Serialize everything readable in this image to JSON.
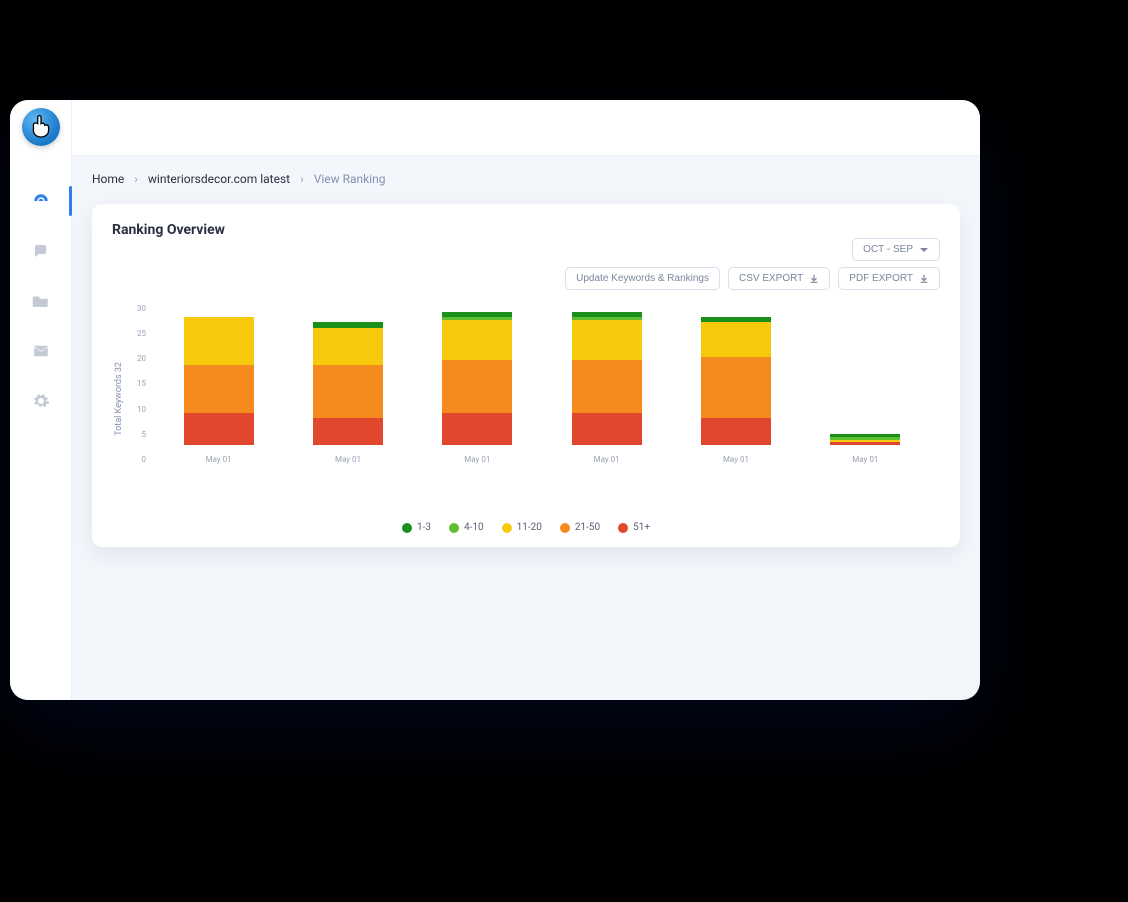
{
  "sidebar": {
    "logo_name": "pointer-logo",
    "items": [
      {
        "name": "dashboard-icon",
        "active": true
      },
      {
        "name": "chat-icon",
        "active": false
      },
      {
        "name": "folder-icon",
        "active": false
      },
      {
        "name": "mail-icon",
        "active": false
      },
      {
        "name": "gear-icon",
        "active": false
      }
    ]
  },
  "breadcrumb": {
    "home": "Home",
    "project": "winteriorsdecor.com latest",
    "current": "View Ranking"
  },
  "card": {
    "title": "Ranking Overview",
    "date_selector": "OCT - SEP",
    "buttons": {
      "update": "Update Keywords & Rankings",
      "csv": "CSV EXPORT",
      "pdf": "PDF EXPORT"
    }
  },
  "chart_data": {
    "type": "bar",
    "title": "Ranking Overview",
    "ylabel": "Total Keywords 32",
    "xlabel": "",
    "ylim": [
      0,
      30
    ],
    "y_ticks": [
      0,
      5,
      10,
      15,
      20,
      25,
      30
    ],
    "categories": [
      "May 01",
      "May 01",
      "May 01",
      "May 01",
      "May 01",
      "May 01"
    ],
    "series": [
      {
        "name": "1-3",
        "color": "#1a8f1a",
        "values": [
          0,
          1,
          1,
          1,
          1,
          0.5
        ]
      },
      {
        "name": "4-10",
        "color": "#5bbf2f",
        "values": [
          0,
          0,
          0.5,
          0.5,
          0,
          0.5
        ]
      },
      {
        "name": "11-20",
        "color": "#f7c90d",
        "values": [
          9,
          7,
          7.5,
          7.5,
          6.5,
          0.5
        ]
      },
      {
        "name": "21-50",
        "color": "#f58a1f",
        "values": [
          9,
          10,
          10,
          10,
          11.5,
          0
        ]
      },
      {
        "name": "51+",
        "color": "#e0472c",
        "values": [
          6,
          5,
          6,
          6,
          5,
          0.5
        ]
      }
    ]
  },
  "colors": {
    "accent": "#2f7ff0"
  }
}
